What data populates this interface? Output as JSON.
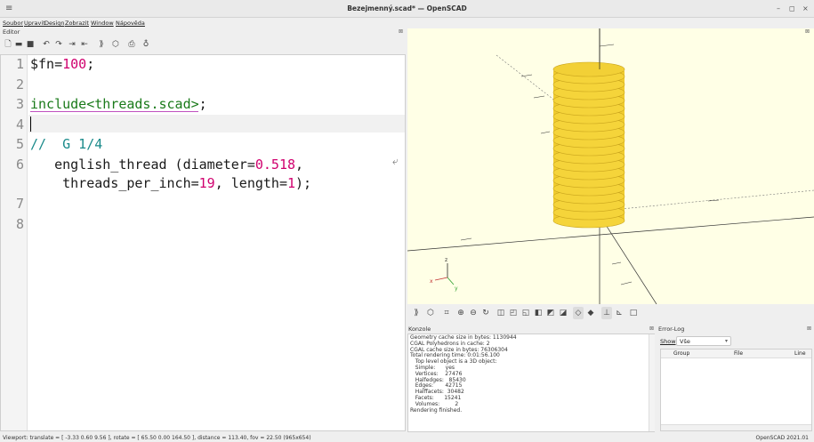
{
  "window": {
    "title": "Bezejmenný.scad* — OpenSCAD",
    "minimize": "–",
    "maximize": "◻",
    "close": "×"
  },
  "menu": [
    "Soubor",
    "Upravit",
    "Design",
    "Zobrazit",
    "Window",
    "Nápověda"
  ],
  "editor": {
    "label": "Editor",
    "float_icon": "⊠",
    "toolbar_icons": [
      "new-file-icon",
      "open-file-icon",
      "save-icon",
      "undo-icon",
      "redo-icon",
      "indent-icon",
      "unindent-icon",
      "preview-icon",
      "render-icon",
      "export-stl-icon",
      "send-to-printer-icon"
    ],
    "line_numbers": [
      "1",
      "2",
      "3",
      "4",
      "5",
      "6",
      "7",
      "8"
    ],
    "code": {
      "l1_a": "$fn=",
      "l1_b": "100",
      "l1_c": ";",
      "l3_a": "include",
      "l3_b": "<threads.scad>",
      "l3_c": ";",
      "l5": "//  G 1/4",
      "l6_a": "   english_thread (diameter=",
      "l6_b": "0.518",
      "l6_c": ",",
      "l6w_a": "    threads_per_inch=",
      "l6w_b": "19",
      "l6w_c": ", length=",
      "l6w_d": "1",
      "l6w_e": ");"
    }
  },
  "viewport": {
    "float_icon": "⊠",
    "axis_labels": [
      "z",
      "x",
      "y"
    ],
    "colors": {
      "background": "#ffffe6",
      "model": "#f0cc30",
      "model_edge": "#c9a41c"
    }
  },
  "view_toolbar_icons": [
    "preview-icon",
    "render-icon",
    "view-all-icon",
    "zoom-in-icon",
    "zoom-out-icon",
    "reset-view-icon",
    "view-right-icon",
    "view-top-icon",
    "view-bottom-icon",
    "view-left-icon",
    "view-front-icon",
    "view-back-icon",
    "perspective-icon",
    "orthogonal-icon",
    "show-axes-icon",
    "show-scale-icon",
    "show-edges-icon"
  ],
  "console": {
    "title": "Konzole",
    "close": "⊠",
    "lines": [
      "Geometry cache size in bytes: 1130944",
      "CGAL Polyhedrons in cache: 2",
      "CGAL cache size in bytes: 76306304",
      "Total rendering time: 0:01:56.100",
      "   Top level object is a 3D object:",
      "   Simple:      yes",
      "   Vertices:    27476",
      "   Halfedges:   85430",
      "   Edges:       42715",
      "   Halffacets:  30482",
      "   Facets:      15241",
      "   Volumes:         2",
      "Rendering finished."
    ]
  },
  "errorlog": {
    "title": "Error-Log",
    "close": "⊠",
    "show_label": "Show",
    "show_value": "Vše",
    "columns": [
      "Group",
      "File",
      "Line"
    ]
  },
  "status": {
    "viewport": "Viewport: translate = [ -3.33 0.60 9.56 ], rotate = [ 65.50 0.00 164.50 ], distance = 113.40, fov = 22.50 (965x654)",
    "version": "OpenSCAD 2021.01"
  }
}
